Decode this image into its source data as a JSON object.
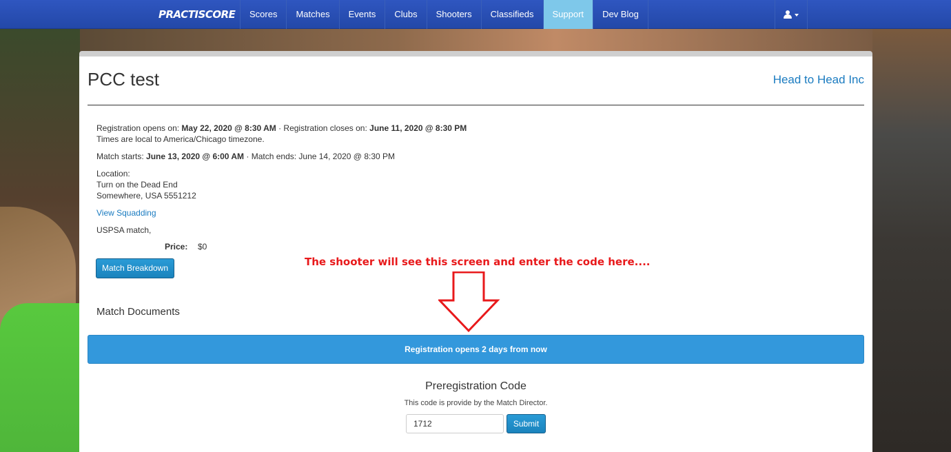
{
  "navbar": {
    "brand": "PRACTISCORE",
    "items": [
      {
        "label": "Scores"
      },
      {
        "label": "Matches"
      },
      {
        "label": "Events"
      },
      {
        "label": "Clubs"
      },
      {
        "label": "Shooters"
      },
      {
        "label": "Classifieds"
      },
      {
        "label": "Support",
        "active": true
      },
      {
        "label": "Dev Blog"
      }
    ],
    "user_icon": "user-icon"
  },
  "match": {
    "title": "PCC test",
    "club": "Head to Head Inc",
    "reg_opens_label": "Registration opens on:",
    "reg_opens_value": "May 22, 2020 @ 8:30 AM",
    "sep": " · ",
    "reg_closes_label": "Registration closes on:",
    "reg_closes_value": "June 11, 2020 @ 8:30 PM",
    "timezone_note": "Times are local to America/Chicago timezone.",
    "starts_label": "Match starts:",
    "starts_value": "June 13, 2020 @ 6:00 AM",
    "ends_text": "Match ends: June 14, 2020 @ 8:30 PM",
    "location_label": "Location:",
    "location_line1": "Turn on the Dead End",
    "location_line2": "Somewhere, USA 5551212",
    "squadding_link": "View Squadding",
    "match_type": "USPSA match,",
    "price_label": "Price:",
    "price_value": "$0",
    "breakdown_button": "Match Breakdown",
    "documents_heading": "Match Documents"
  },
  "registration": {
    "banner": "Registration opens 2 days from now",
    "prereg_title": "Preregistration Code",
    "prereg_subtitle": "This code is provide by the Match Director.",
    "code_value": "1712",
    "submit_label": "Submit"
  },
  "annotation": {
    "text": "The shooter will see this screen and enter the code here....",
    "color": "#e8191b"
  },
  "colors": {
    "navbar": "#2a50b8",
    "active_nav": "#7ec8ea",
    "link": "#1a7bc0",
    "button": "#1f8ecb",
    "banner": "#3398dc"
  }
}
